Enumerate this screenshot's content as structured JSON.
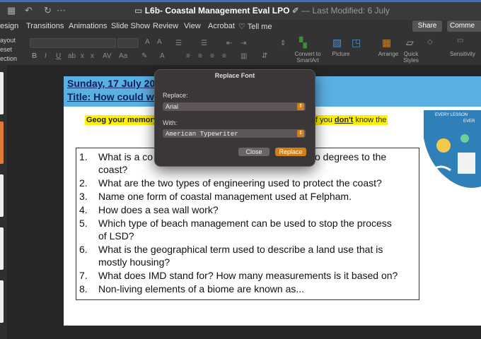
{
  "window": {
    "title": "L6b- Coastal Management Eval LPO",
    "modified": "— Last Modified: 6 July"
  },
  "tabs": [
    "esign",
    "Transitions",
    "Animations",
    "Slide Show",
    "Review",
    "View",
    "Acrobat",
    "Tell me"
  ],
  "toolbar": {
    "share": "Share",
    "comments": "Comme",
    "left_labels": [
      "ayout",
      "eset",
      "ection"
    ],
    "convert_label": "Convert to SmartArt",
    "picture_label": "Picture",
    "arrange_label": "Arrange",
    "quick_styles_label": "Quick Styles",
    "sensitivity_label": "Sensitivity"
  },
  "slide": {
    "date": "Sunday, 17 July 202",
    "title": "Title: How could w",
    "memory_prefix": "Geog your memory:",
    "memory_suffix_pre": "f you ",
    "memory_suffix_emph": "don't",
    "memory_suffix_post": " know the",
    "badge_text_1": "EVERY LESSON",
    "badge_text_2": "EVER",
    "questions": [
      {
        "n": "1.",
        "lines": [
          "What is a co",
          "coast?"
        ],
        "line1_end": "o degrees to the"
      },
      {
        "n": "2.",
        "lines": [
          "What are the two types of engineering used to protect the coast?"
        ]
      },
      {
        "n": "3.",
        "lines": [
          "Name one form of coastal management used at Felpham."
        ]
      },
      {
        "n": "4.",
        "lines": [
          "How does a sea wall work?"
        ]
      },
      {
        "n": "5.",
        "lines": [
          "Which type of beach management can be used to stop the process",
          "of LSD?"
        ]
      },
      {
        "n": "6.",
        "lines": [
          "What is the geographical term used to describe a land use that is",
          "mostly housing?"
        ]
      },
      {
        "n": "7.",
        "lines": [
          "What does IMD stand for? How many measurements is it based on?"
        ]
      },
      {
        "n": "8.",
        "lines": [
          "Non-living elements of a biome are known as..."
        ]
      }
    ]
  },
  "dialog": {
    "title": "Replace Font",
    "replace_label": "Replace:",
    "replace_value": "Arial",
    "with_label": "With:",
    "with_value": "American Typewriter",
    "close": "Close",
    "replace_button": "Replace"
  },
  "colors": {
    "accent": "#d0801a",
    "slide_band": "#5aafe3",
    "highlight": "#fff200"
  }
}
